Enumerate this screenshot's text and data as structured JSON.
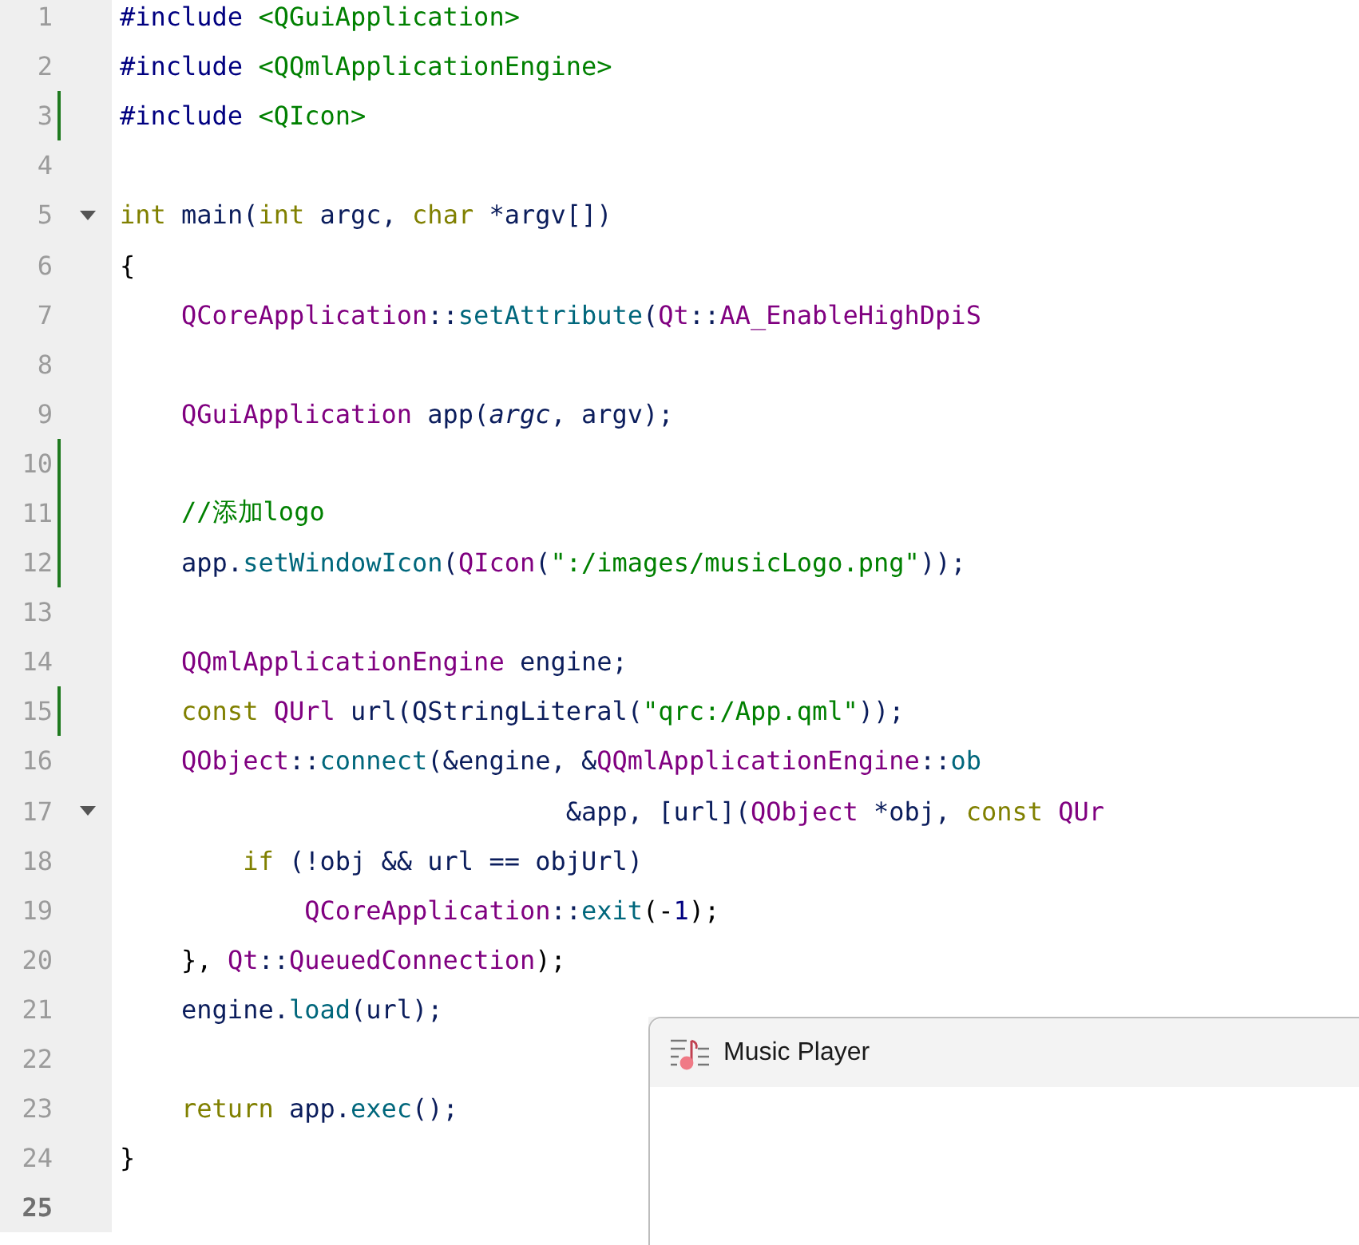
{
  "editor": {
    "lines": [
      {
        "number": "1",
        "modified": false,
        "foldable": false,
        "current": false,
        "tokens": [
          {
            "t": "#include",
            "kind": "preproc"
          },
          {
            "t": " <QGuiApplication>",
            "kind": "string"
          }
        ]
      },
      {
        "number": "2",
        "modified": false,
        "foldable": false,
        "current": false,
        "tokens": [
          {
            "t": "#include",
            "kind": "preproc"
          },
          {
            "t": " <QQmlApplicationEngine>",
            "kind": "string"
          }
        ]
      },
      {
        "number": "3",
        "modified": true,
        "foldable": false,
        "current": false,
        "tokens": [
          {
            "t": "#include",
            "kind": "preproc"
          },
          {
            "t": " <QIcon>",
            "kind": "string"
          }
        ]
      },
      {
        "number": "4",
        "modified": false,
        "foldable": false,
        "current": false
      },
      {
        "number": "5",
        "modified": false,
        "foldable": true,
        "current": false,
        "tokens": [
          {
            "t": "int",
            "kind": "keyword"
          },
          {
            "t": " main(",
            "kind": "plain"
          },
          {
            "t": "int",
            "kind": "keyword"
          },
          {
            "t": " argc, ",
            "kind": "plain"
          },
          {
            "t": "char",
            "kind": "keyword"
          },
          {
            "t": " *argv[])",
            "kind": "plain"
          }
        ]
      },
      {
        "number": "6",
        "modified": false,
        "foldable": false,
        "current": false,
        "tokens": [
          {
            "t": "{",
            "kind": "punct"
          }
        ]
      },
      {
        "number": "7",
        "modified": false,
        "foldable": false,
        "current": false,
        "tokens": [
          {
            "t": "    QCoreApplication",
            "kind": "type"
          },
          {
            "t": "::",
            "kind": "plain"
          },
          {
            "t": "setAttribute",
            "kind": "func"
          },
          {
            "t": "(",
            "kind": "plain"
          },
          {
            "t": "Qt",
            "kind": "type"
          },
          {
            "t": "::",
            "kind": "plain"
          },
          {
            "t": "AA_EnableHighDpiS",
            "kind": "type"
          }
        ]
      },
      {
        "number": "8",
        "modified": false,
        "foldable": false,
        "current": false
      },
      {
        "number": "9",
        "modified": false,
        "foldable": false,
        "current": false,
        "tokens": [
          {
            "t": "    QGuiApplication",
            "kind": "type"
          },
          {
            "t": " app(",
            "kind": "plain"
          },
          {
            "t": "argc",
            "kind": "param"
          },
          {
            "t": ", argv);",
            "kind": "plain"
          }
        ]
      },
      {
        "number": "10",
        "modified": true,
        "foldable": false,
        "current": false
      },
      {
        "number": "11",
        "modified": true,
        "foldable": false,
        "current": false,
        "tokens": [
          {
            "t": "    //添加logo",
            "kind": "comment"
          }
        ]
      },
      {
        "number": "12",
        "modified": true,
        "foldable": false,
        "current": false,
        "tokens": [
          {
            "t": "    app.",
            "kind": "plain"
          },
          {
            "t": "setWindowIcon",
            "kind": "func"
          },
          {
            "t": "(",
            "kind": "plain"
          },
          {
            "t": "QIcon",
            "kind": "type"
          },
          {
            "t": "(",
            "kind": "plain"
          },
          {
            "t": "\":/images/musicLogo.png\"",
            "kind": "string"
          },
          {
            "t": "));",
            "kind": "plain"
          }
        ]
      },
      {
        "number": "13",
        "modified": false,
        "foldable": false,
        "current": false
      },
      {
        "number": "14",
        "modified": false,
        "foldable": false,
        "current": false,
        "tokens": [
          {
            "t": "    QQmlApplicationEngine",
            "kind": "type"
          },
          {
            "t": " engine;",
            "kind": "plain"
          }
        ]
      },
      {
        "number": "15",
        "modified": true,
        "foldable": false,
        "current": false,
        "tokens": [
          {
            "t": "    const",
            "kind": "keyword"
          },
          {
            "t": " QUrl",
            "kind": "type"
          },
          {
            "t": " url(QStringLiteral(",
            "kind": "plain"
          },
          {
            "t": "\"qrc:/App.qml\"",
            "kind": "string"
          },
          {
            "t": "));",
            "kind": "plain"
          }
        ]
      },
      {
        "number": "16",
        "modified": false,
        "foldable": false,
        "current": false,
        "tokens": [
          {
            "t": "    QObject",
            "kind": "type"
          },
          {
            "t": "::",
            "kind": "plain"
          },
          {
            "t": "connect",
            "kind": "func"
          },
          {
            "t": "(&engine, &",
            "kind": "plain"
          },
          {
            "t": "QQmlApplicationEngine",
            "kind": "type"
          },
          {
            "t": "::",
            "kind": "plain"
          },
          {
            "t": "ob",
            "kind": "func"
          }
        ]
      },
      {
        "number": "17",
        "modified": false,
        "foldable": true,
        "current": false,
        "tokens": [
          {
            "t": "                             &app, [url](",
            "kind": "plain"
          },
          {
            "t": "QObject",
            "kind": "type"
          },
          {
            "t": " *obj, ",
            "kind": "plain"
          },
          {
            "t": "const",
            "kind": "keyword"
          },
          {
            "t": " QUr",
            "kind": "type"
          }
        ]
      },
      {
        "number": "18",
        "modified": false,
        "foldable": false,
        "current": false,
        "tokens": [
          {
            "t": "        if",
            "kind": "keyword"
          },
          {
            "t": " (!obj && url == objUrl)",
            "kind": "plain"
          }
        ]
      },
      {
        "number": "19",
        "modified": false,
        "foldable": false,
        "current": false,
        "tokens": [
          {
            "t": "            QCoreApplication",
            "kind": "type"
          },
          {
            "t": "::",
            "kind": "plain"
          },
          {
            "t": "exit",
            "kind": "func"
          },
          {
            "t": "(-",
            "kind": "punct"
          },
          {
            "t": "1",
            "kind": "number"
          },
          {
            "t": ");",
            "kind": "punct"
          }
        ]
      },
      {
        "number": "20",
        "modified": false,
        "foldable": false,
        "current": false,
        "tokens": [
          {
            "t": "    }, ",
            "kind": "punct"
          },
          {
            "t": "Qt",
            "kind": "type"
          },
          {
            "t": "::",
            "kind": "plain"
          },
          {
            "t": "QueuedConnection",
            "kind": "type"
          },
          {
            "t": ");",
            "kind": "punct"
          }
        ]
      },
      {
        "number": "21",
        "modified": false,
        "foldable": false,
        "current": false,
        "tokens": [
          {
            "t": "    engine.",
            "kind": "plain"
          },
          {
            "t": "load",
            "kind": "func"
          },
          {
            "t": "(url);",
            "kind": "plain"
          }
        ]
      },
      {
        "number": "22",
        "modified": false,
        "foldable": false,
        "current": false
      },
      {
        "number": "23",
        "modified": false,
        "foldable": false,
        "current": false,
        "tokens": [
          {
            "t": "    return",
            "kind": "keyword"
          },
          {
            "t": " app.",
            "kind": "plain"
          },
          {
            "t": "exec",
            "kind": "func"
          },
          {
            "t": "();",
            "kind": "plain"
          }
        ]
      },
      {
        "number": "24",
        "modified": false,
        "foldable": false,
        "current": false,
        "tokens": [
          {
            "t": "}",
            "kind": "punct"
          }
        ]
      },
      {
        "number": "25",
        "modified": false,
        "foldable": false,
        "current": true
      }
    ]
  },
  "app_window": {
    "title": "Music Player"
  }
}
